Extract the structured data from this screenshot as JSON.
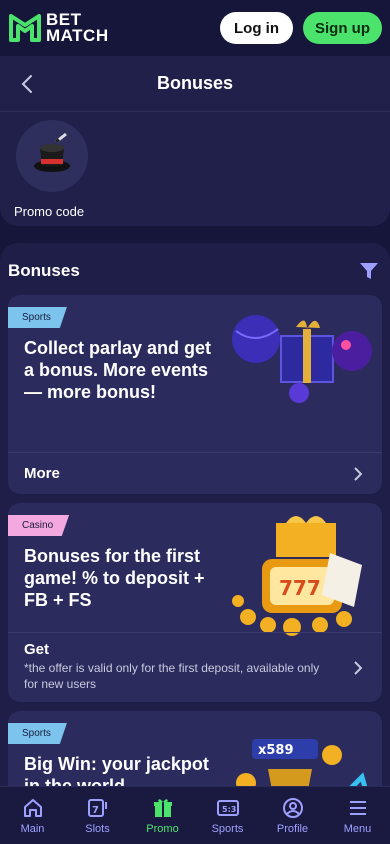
{
  "header": {
    "logo_line1": "BET",
    "logo_line2": "MATCH",
    "login_label": "Log in",
    "signup_label": "Sign up"
  },
  "page": {
    "title": "Bonuses"
  },
  "promo": {
    "label": "Promo code"
  },
  "section": {
    "title": "Bonuses"
  },
  "cards": [
    {
      "tag": "Sports",
      "title": "Collect parlay and get a bonus. More events — more bonus!",
      "footer": "More",
      "note": ""
    },
    {
      "tag": "Casino",
      "title": "Bonuses for the first game! % to deposit + FB + FS",
      "footer": "Get",
      "note": "*the offer is valid only for the first deposit, available only for new users"
    },
    {
      "tag": "Sports",
      "title": "Big Win: your jackpot in the world",
      "footer": "",
      "note": "",
      "badge": "x589"
    }
  ],
  "nav": [
    {
      "label": "Main",
      "icon": "home-icon"
    },
    {
      "label": "Slots",
      "icon": "slots-icon"
    },
    {
      "label": "Promo",
      "icon": "gift-icon",
      "active": true
    },
    {
      "label": "Sports",
      "icon": "scoreboard-icon"
    },
    {
      "label": "Profile",
      "icon": "profile-icon"
    },
    {
      "label": "Menu",
      "icon": "menu-icon"
    }
  ],
  "colors": {
    "background": "#16163a",
    "card": "#2b2b5d",
    "accent_green": "#4be36b",
    "nav_text": "#9ea0ff",
    "sports_tag": "#7cc4ee",
    "casino_tag": "#f3a8e0"
  }
}
